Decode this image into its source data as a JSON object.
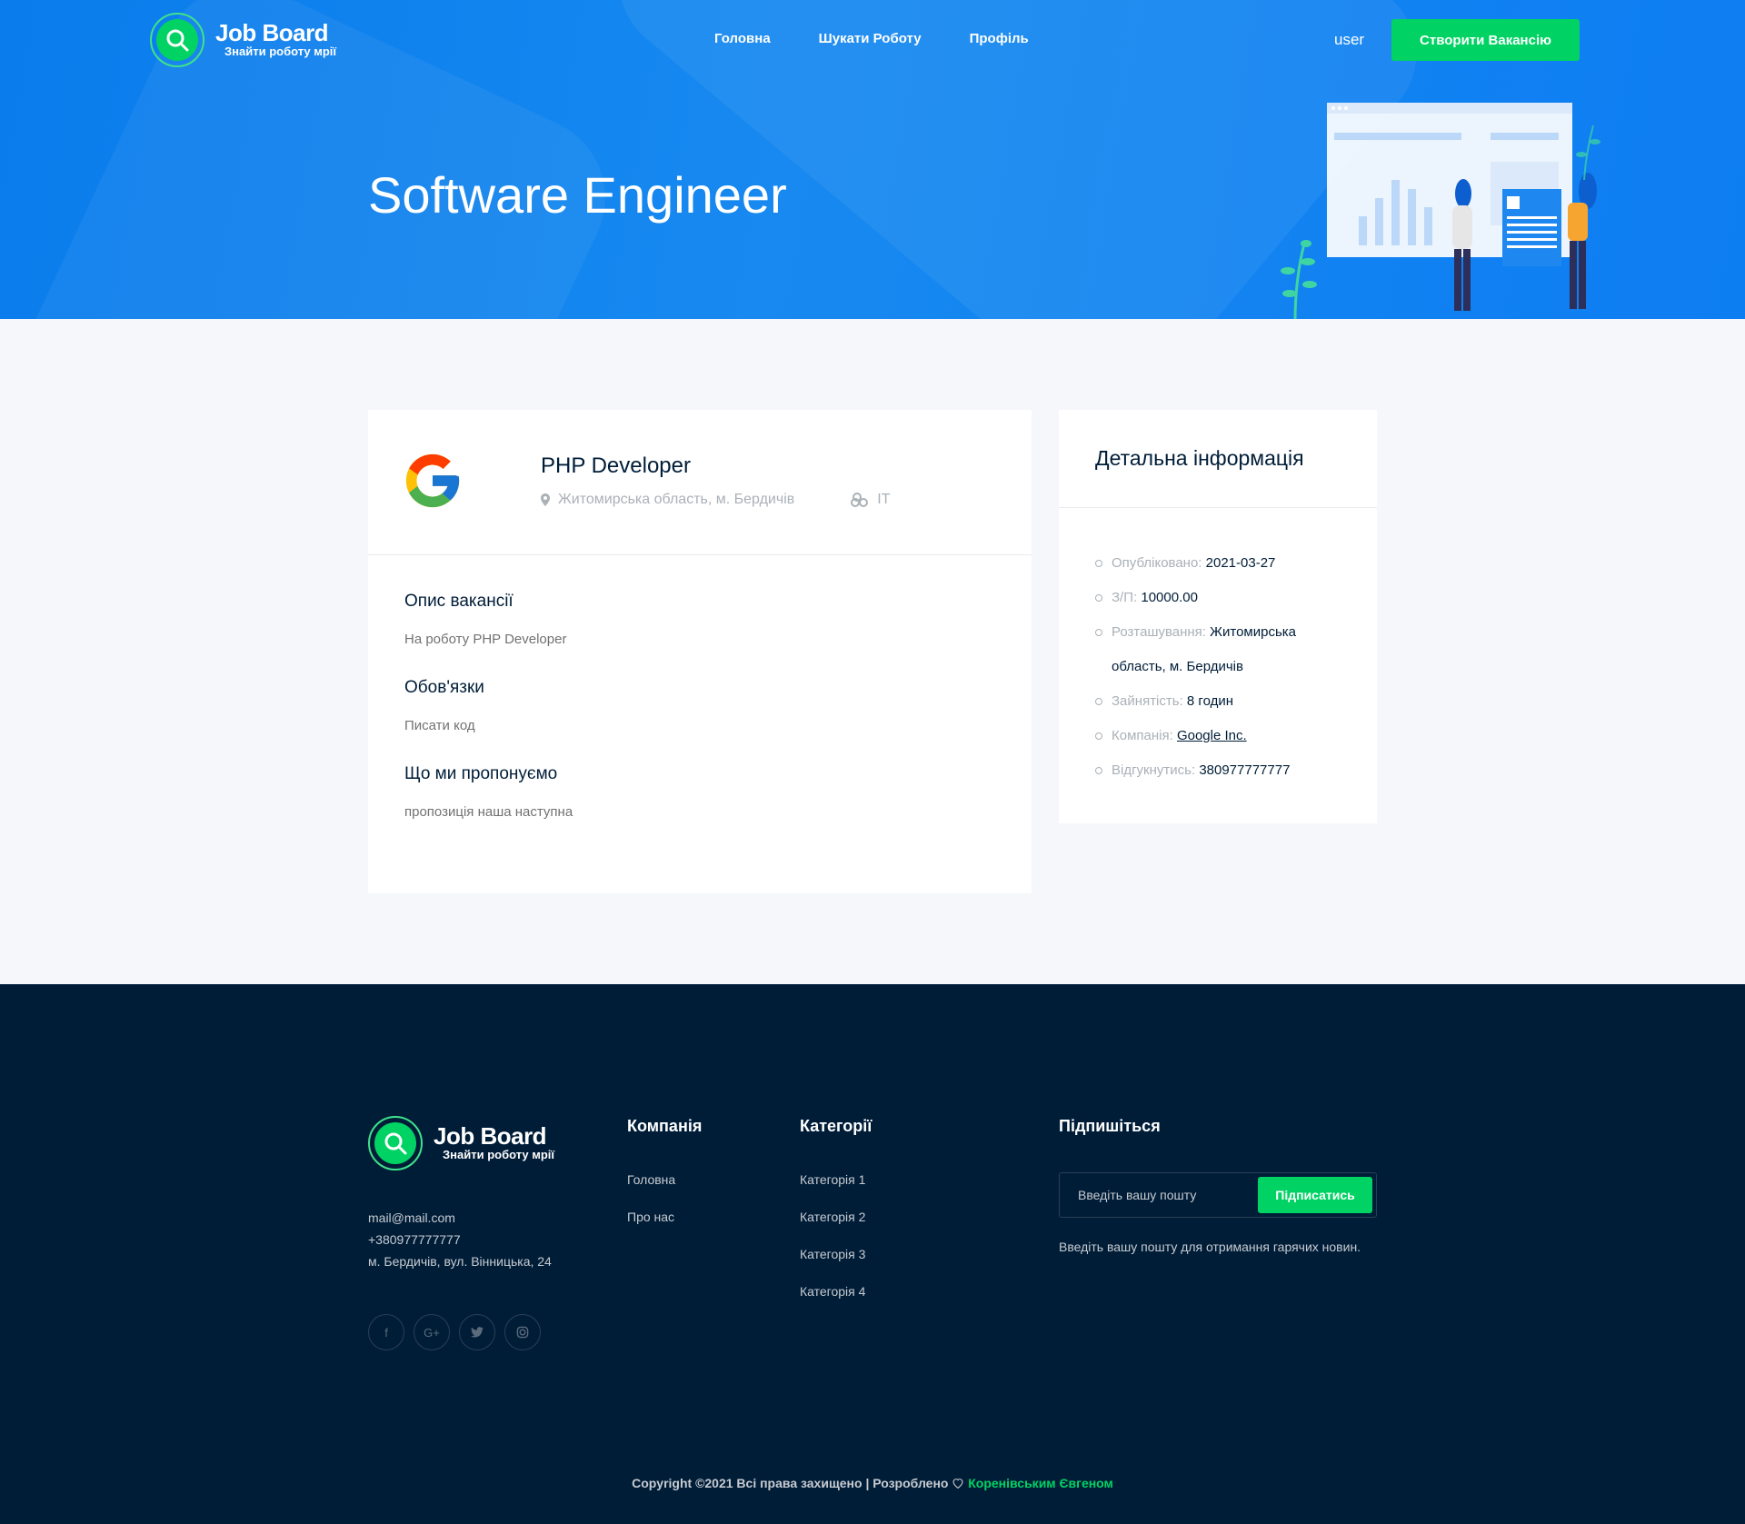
{
  "header": {
    "logo_name": "Job Board",
    "logo_tagline": "Знайти роботу мрії",
    "nav": [
      "Головна",
      "Шукати Роботу",
      "Профіль"
    ],
    "user": "user",
    "create_button": "Створити Вакансію",
    "title": "Software Engineer"
  },
  "job": {
    "company_logo": "google-logo",
    "title": "PHP Developer",
    "location": "Житомирська область, м. Бердичів",
    "category": "IT",
    "sections": [
      {
        "heading": "Опис вакансії",
        "text": "На роботу PHP Developer"
      },
      {
        "heading": "Обов'язки",
        "text": "Писати код"
      },
      {
        "heading": "Що ми пропонуємо",
        "text": "пропозиція наша наступна"
      }
    ]
  },
  "details": {
    "title": "Детальна інформація",
    "items": [
      {
        "key": "Опубліковано:",
        "value": "2021-03-27"
      },
      {
        "key": "З/П:",
        "value": "10000.00"
      },
      {
        "key": "Розташування:",
        "value": "Житомирська область, м. Бердичів"
      },
      {
        "key": "Зайнятість:",
        "value": "8 годин"
      },
      {
        "key": "Компанія:",
        "value": "Google Inc."
      },
      {
        "key": "Відгукнутись:",
        "value": "380977777777"
      }
    ]
  },
  "footer": {
    "logo_name": "Job Board",
    "logo_tagline": "Знайти роботу мрії",
    "email": "mail@mail.com",
    "phone": "+380977777777",
    "address": "м. Бердичів, вул. Вінницька, 24",
    "socials": [
      "facebook-icon",
      "google-plus-icon",
      "twitter-icon",
      "instagram-icon"
    ],
    "company_title": "Компанія",
    "company_links": [
      "Головна",
      "Про нас"
    ],
    "categories_title": "Категорії",
    "categories": [
      "Категорія 1",
      "Категорія 2",
      "Категорія 3",
      "Категорія 4"
    ],
    "subscribe_title": "Підпишіться",
    "subscribe_placeholder": "Введіть вашу пошту",
    "subscribe_button": "Підписатись",
    "subscribe_note": "Введіть вашу пошту для отримання гарячих новин.",
    "copyright_prefix": "Copyright ©2021 Всі права захищено | Розроблено",
    "copyright_author": "Коренівським Євгеном"
  },
  "colors": {
    "hero_blue": "#0d7df2",
    "accent_green": "#00d363",
    "footer_bg": "#001d38"
  }
}
